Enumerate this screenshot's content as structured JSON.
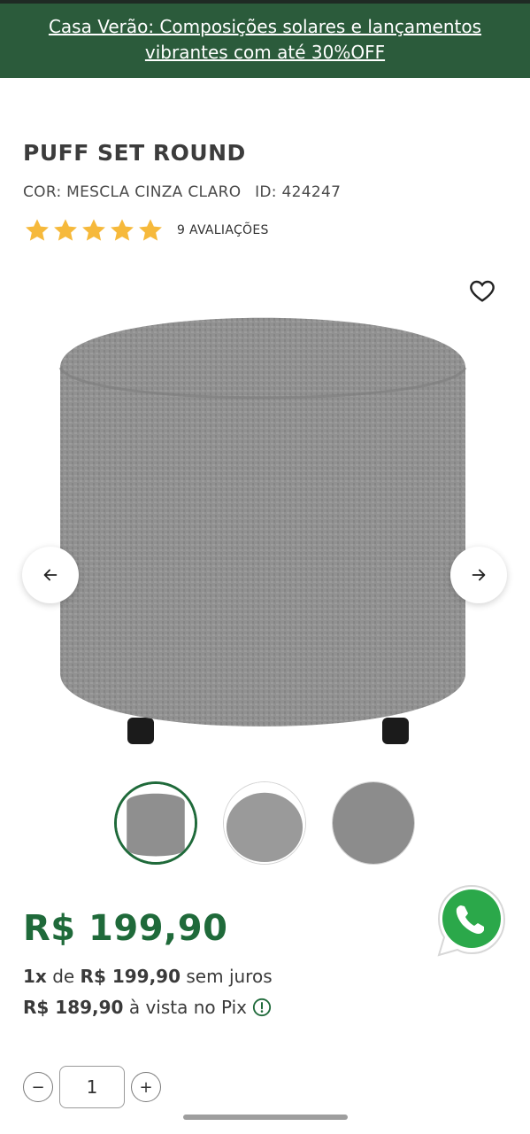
{
  "promo": {
    "text": "Casa Verão: Composições solares e lançamentos vibrantes com até 30%OFF"
  },
  "product": {
    "title": "PUFF SET ROUND",
    "color_label": "COR: MESCLA CINZA CLARO",
    "id_label": "ID: 424247",
    "rating": {
      "stars": 5,
      "max": 5,
      "count_label": "9 AVALIAÇÕES"
    }
  },
  "gallery": {
    "prev_icon": "arrow-left-icon",
    "next_icon": "arrow-right-icon",
    "favorite_icon": "heart-outline-icon",
    "thumbnails": [
      "front-view",
      "top-view",
      "close-up"
    ],
    "active_thumbnail": 0
  },
  "pricing": {
    "price": "R$ 199,90",
    "installments_prefix": "1x",
    "installments_middle": "de",
    "installments_value": "R$ 199,90",
    "installments_suffix": "sem juros",
    "pix_value": "R$ 189,90",
    "pix_suffix": "à vista no Pix",
    "info_icon": "info-circle-icon"
  },
  "quantity": {
    "minus": "−",
    "value": "1",
    "plus": "+"
  },
  "colors": {
    "brand_green": "#1f6a3a",
    "promo_bg": "#2b5b3b",
    "star": "#f6b93b",
    "whatsapp": "#2ba84a"
  }
}
